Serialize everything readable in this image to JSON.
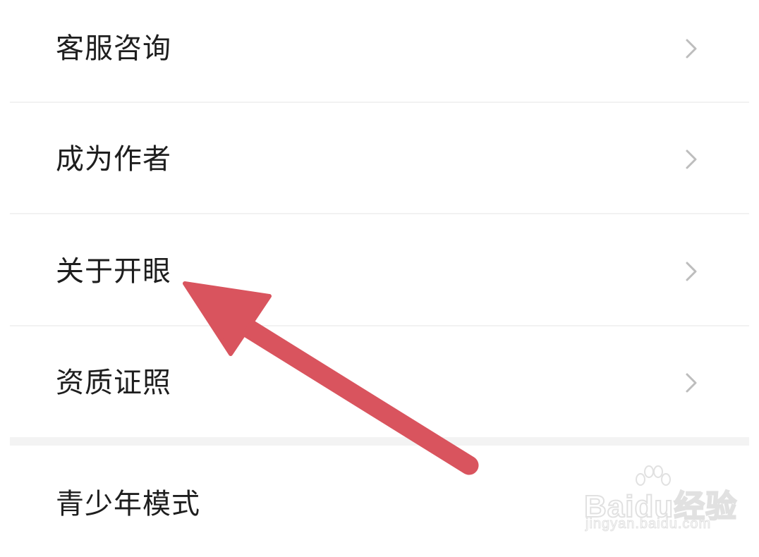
{
  "menu": {
    "items": [
      {
        "label": "客服咨询"
      },
      {
        "label": "成为作者"
      },
      {
        "label": "关于开眼"
      },
      {
        "label": "资质证照"
      },
      {
        "label": "青少年模式"
      }
    ]
  },
  "annotation": {
    "arrow_color": "#d9545e",
    "arrow_target": "关于开眼"
  },
  "watermark": {
    "brand_pre": "Bai",
    "brand_du": "du",
    "brand_cn": "经验",
    "url": "jingyan.baidu.com"
  },
  "icons": {
    "row_chevron": "chevron-right-icon",
    "watermark_logo": "baidu-paw-icon"
  }
}
